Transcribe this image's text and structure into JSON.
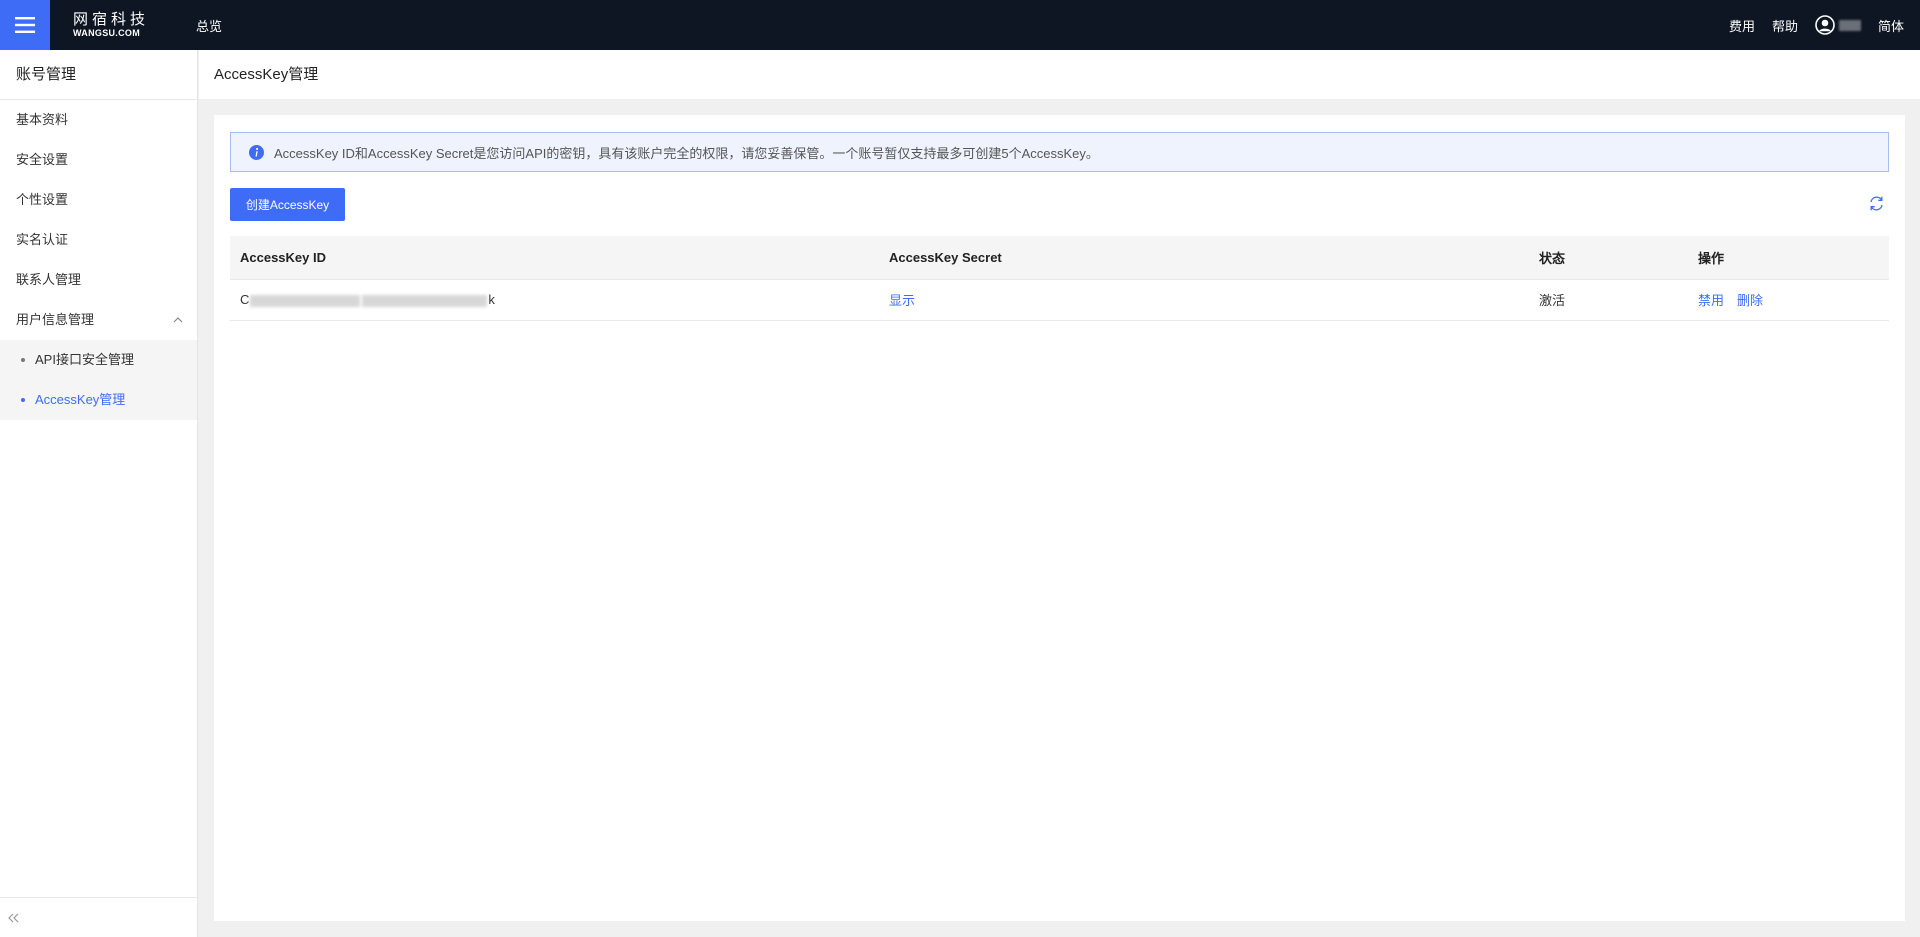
{
  "header": {
    "logo_cn": "网宿科技",
    "logo_en": "WANGSU.COM",
    "nav_overview": "总览",
    "links": {
      "billing": "费用",
      "help": "帮助",
      "language": "简体"
    },
    "accent_color": "#3e6cf6",
    "background_color": "#0f1623"
  },
  "sidebar": {
    "title": "账号管理",
    "items": [
      {
        "label": "基本资料"
      },
      {
        "label": "安全设置"
      },
      {
        "label": "个性设置"
      },
      {
        "label": "实名认证"
      },
      {
        "label": "联系人管理"
      },
      {
        "label": "用户信息管理",
        "expanded": true
      }
    ],
    "sub_items": [
      {
        "label": "API接口安全管理",
        "active": false
      },
      {
        "label": "AccessKey管理",
        "active": true
      }
    ],
    "icons": {
      "menu": "hamburger-icon",
      "collapse": "double-chevron-left-icon",
      "expand": "chevron-up-icon"
    }
  },
  "page": {
    "title": "AccessKey管理",
    "info_message": "AccessKey ID和AccessKey Secret是您访问API的密钥，具有该账户完全的权限，请您妥善保管。一个账号暂仅支持最多可创建5个AccessKey。",
    "create_button": "创建AccessKey",
    "table": {
      "columns": [
        "AccessKey ID",
        "AccessKey Secret",
        "状态",
        "操作"
      ],
      "rows": [
        {
          "id_prefix": "C",
          "id_suffix": "k",
          "secret_action": "显示",
          "status": "激活",
          "actions": [
            "禁用",
            "删除"
          ]
        }
      ]
    }
  }
}
